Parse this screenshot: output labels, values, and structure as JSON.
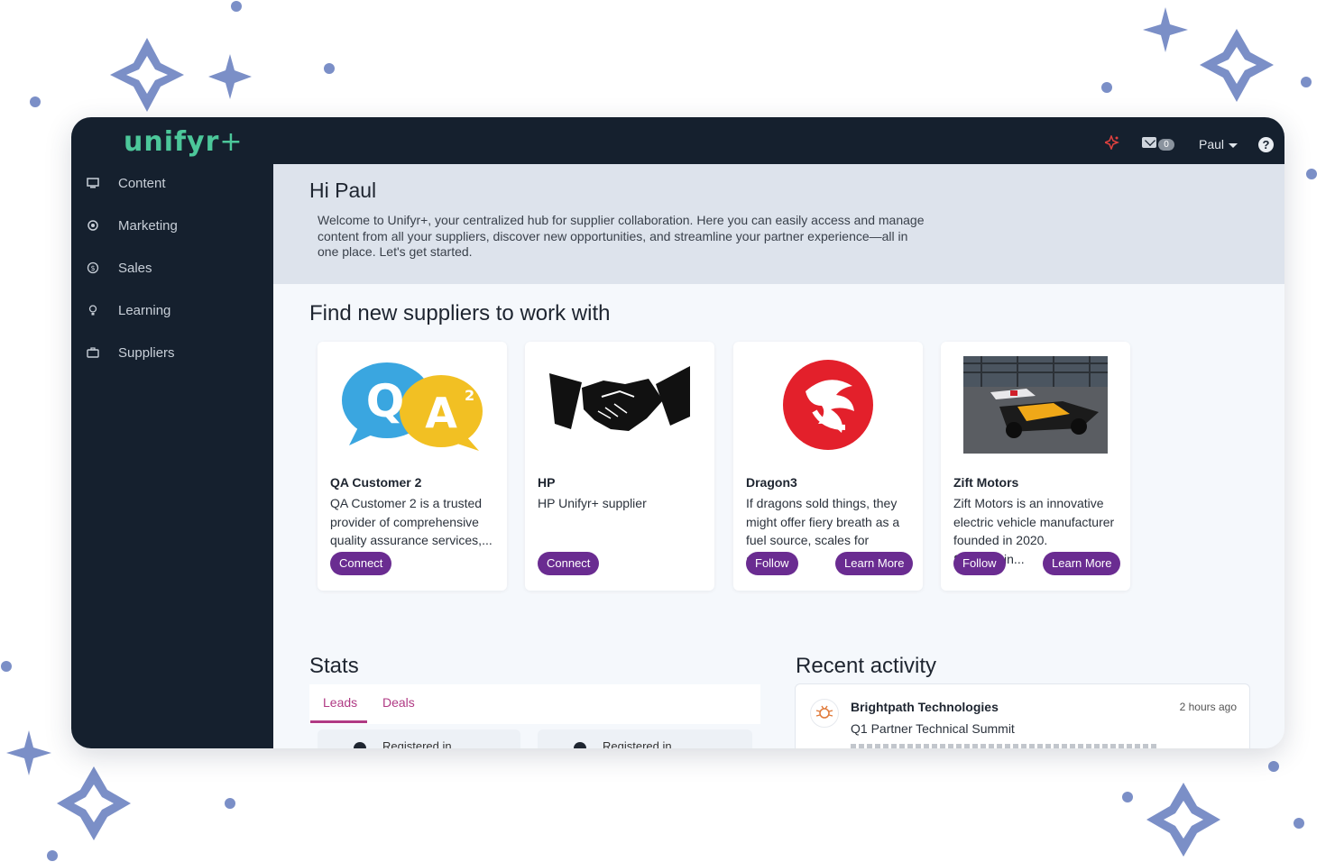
{
  "app": {
    "logo_main": "unifyr",
    "logo_plus": "+"
  },
  "topbar": {
    "mail_count": "0",
    "user_name": "Paul",
    "help_label": "?"
  },
  "sidebar": {
    "items": [
      {
        "label": "Content",
        "icon": "monitor-icon"
      },
      {
        "label": "Marketing",
        "icon": "megaphone-icon"
      },
      {
        "label": "Sales",
        "icon": "dollar-icon"
      },
      {
        "label": "Learning",
        "icon": "lightbulb-icon"
      },
      {
        "label": "Suppliers",
        "icon": "briefcase-icon"
      }
    ]
  },
  "hero": {
    "greeting": "Hi Paul",
    "welcome": "Welcome to Unifyr+, your centralized hub for supplier collaboration. Here you can easily access and manage content from all your suppliers, discover new opportunities, and streamline your partner experience—all in one place. Let's get started."
  },
  "suppliers": {
    "title": "Find new suppliers to work with",
    "cards": [
      {
        "name": "QA Customer 2",
        "description": "QA Customer 2 is a trusted provider of comprehensive quality assurance services,...",
        "buttons": [
          "Connect"
        ]
      },
      {
        "name": "HP",
        "description": "HP Unifyr+ supplier",
        "buttons": [
          "Connect"
        ]
      },
      {
        "name": "Dragon3",
        "description": "If dragons sold things, they might offer fiery breath as a fuel source, scales for armor...",
        "buttons": [
          "Follow",
          "Learn More"
        ]
      },
      {
        "name": "Zift Motors",
        "description": "Zift Motors is an innovative electric vehicle manufacturer founded in 2020. Specializin...",
        "buttons": [
          "Follow",
          "Learn More"
        ]
      }
    ]
  },
  "stats": {
    "title": "Stats",
    "tabs": [
      "Leads",
      "Deals"
    ],
    "box_labels": [
      "Registered in",
      "Registered in"
    ]
  },
  "activity": {
    "title": "Recent activity",
    "items": [
      {
        "company": "Brightpath Technologies",
        "time": "2 hours ago",
        "event": "Q1 Partner Technical Summit"
      }
    ]
  },
  "colors": {
    "sidebar": "#15202e",
    "accent_purple": "#6a2c91",
    "tab_pink": "#b03a84",
    "logo_green": "#4cc79a",
    "sparkle": "#7b8fc7"
  }
}
